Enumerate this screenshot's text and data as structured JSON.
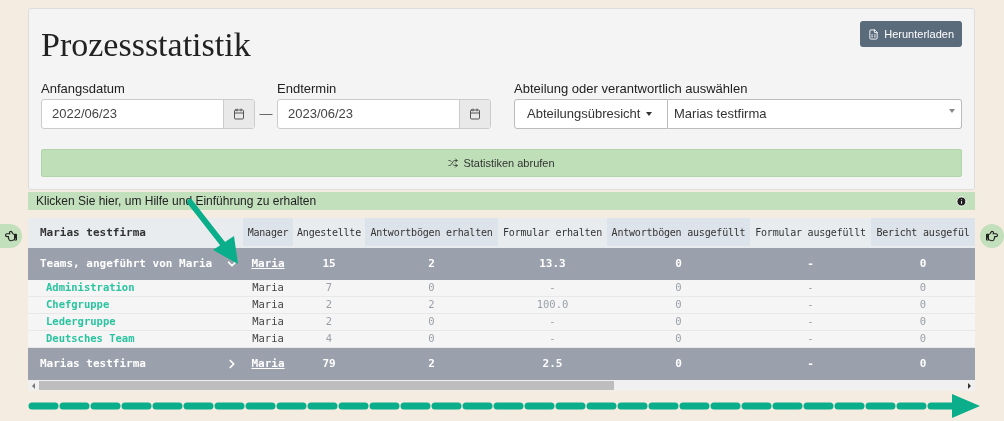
{
  "title": "Prozessstatistik",
  "download_button": "Herunterladen",
  "start_date": {
    "label": "Anfangsdatum",
    "value": "2022/06/23"
  },
  "end_date": {
    "label": "Endtermin",
    "value": "2023/06/23"
  },
  "date_separator": "—",
  "department": {
    "label": "Abteilung oder verantwortlich auswählen",
    "mode": "Abteilungsübresicht",
    "value": "Marias testfirma"
  },
  "fetch_button": "Statistiken abrufen",
  "help_bar": "Klicken Sie hier, um Hilfe und Einführung zu erhalten",
  "table": {
    "columns": [
      "Marias testfirma",
      "Manager",
      "Angestellte",
      "Antwortbögen erhalten",
      "Formular erhalten",
      "Antwortbögen ausgefüllt",
      "Formular ausgefüllt",
      "Bericht ausgefül"
    ],
    "groups": [
      {
        "name": "Teams, angeführt von Maria",
        "expanded": true,
        "manager": "Maria",
        "values": [
          "15",
          "2",
          "13.3",
          "0",
          "-",
          "0"
        ],
        "rows": [
          {
            "name": "Administration",
            "manager": "Maria",
            "values": [
              "7",
              "0",
              "-",
              "0",
              "-",
              "0"
            ]
          },
          {
            "name": "Chefgruppe",
            "manager": "Maria",
            "values": [
              "2",
              "2",
              "100.0",
              "0",
              "-",
              "0"
            ]
          },
          {
            "name": "Ledergruppe",
            "manager": "Maria",
            "values": [
              "2",
              "0",
              "-",
              "0",
              "-",
              "0"
            ]
          },
          {
            "name": "Deutsches Team",
            "manager": "Maria",
            "values": [
              "4",
              "0",
              "-",
              "0",
              "-",
              "0"
            ]
          }
        ]
      },
      {
        "name": "Marias testfirma",
        "expanded": false,
        "manager": "Maria",
        "values": [
          "79",
          "2",
          "2.5",
          "0",
          "-",
          "0"
        ]
      }
    ]
  }
}
